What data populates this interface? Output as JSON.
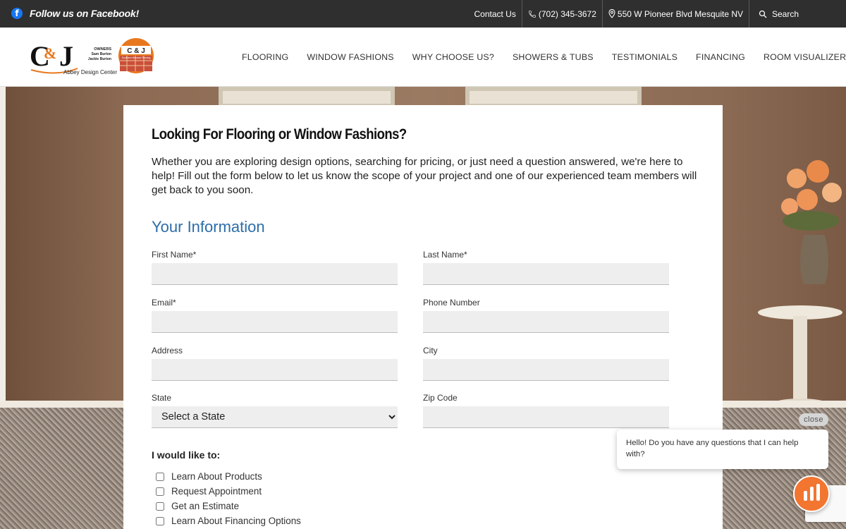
{
  "topbar": {
    "facebook_label": "Follow us on Facebook!",
    "contact_label": "Contact Us",
    "phone": "(702) 345-3672",
    "address": "550 W Pioneer Blvd Mesquite NV",
    "search_label": "Search"
  },
  "logo": {
    "owners_title": "OWNERS",
    "owner1": "Sam Burton",
    "owner2": "Jackie Burton",
    "caption": "Abbey Design Center",
    "badge": "C & J",
    "badge_sub": "Southern Nevada Flooring"
  },
  "nav": {
    "items": [
      "FLOORING",
      "WINDOW FASHIONS",
      "WHY CHOOSE US?",
      "SHOWERS & TUBS",
      "TESTIMONIALS",
      "FINANCING",
      "ROOM VISUALIZER"
    ]
  },
  "form": {
    "heading": "Looking For Flooring or Window Fashions?",
    "intro": "Whether you are exploring design options, searching for pricing, or just need a question answered, we're here to help! Fill out the form below to let us know the scope of your project and one of our experienced team members will get back to you soon.",
    "section_title": "Your Information",
    "fields": {
      "first_name": "First Name*",
      "last_name": "Last Name*",
      "email": "Email*",
      "phone": "Phone Number",
      "address": "Address",
      "city": "City",
      "state": "State",
      "zip": "Zip Code"
    },
    "state_selected": "Select a State",
    "like_label": "I would like to:",
    "options": [
      "Learn About Products",
      "Request Appointment",
      "Get an Estimate",
      "Learn About Financing Options"
    ]
  },
  "chat": {
    "close_label": "close",
    "message": "Hello! Do you have any questions that I can help with?"
  },
  "colors": {
    "topbar_bg": "#2f2f2f",
    "accent_blue": "#2c6da8",
    "chat_orange": "#f27530",
    "logo_orange": "#e8781e"
  }
}
